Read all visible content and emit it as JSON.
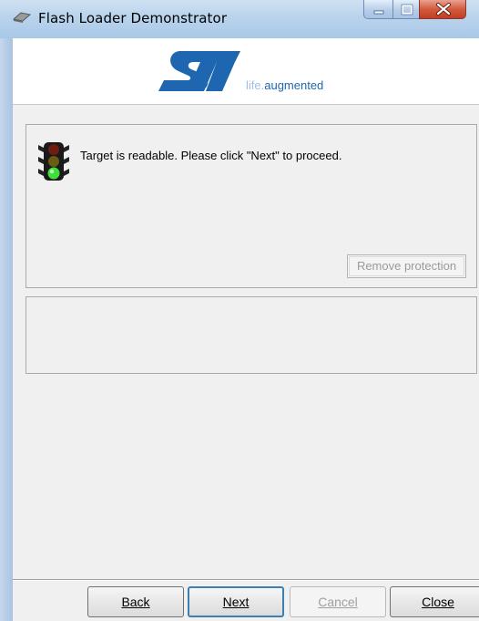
{
  "window": {
    "title": "Flash Loader Demonstrator"
  },
  "banner": {
    "logo": "st-logo",
    "tagline_prefix": "life.",
    "tagline_suffix": "augmented"
  },
  "status": {
    "icon": "traffic-light-green-icon",
    "message": "Target is readable. Please click \"Next\" to proceed.",
    "remove_protection_label": "Remove protection"
  },
  "buttons": {
    "back": "Back",
    "next": "Next",
    "cancel": "Cancel",
    "close": "Close"
  },
  "colors": {
    "st_blue": "#1f66b0",
    "light_green": "#3ee03a",
    "titlebar": "#b9d3ec"
  }
}
